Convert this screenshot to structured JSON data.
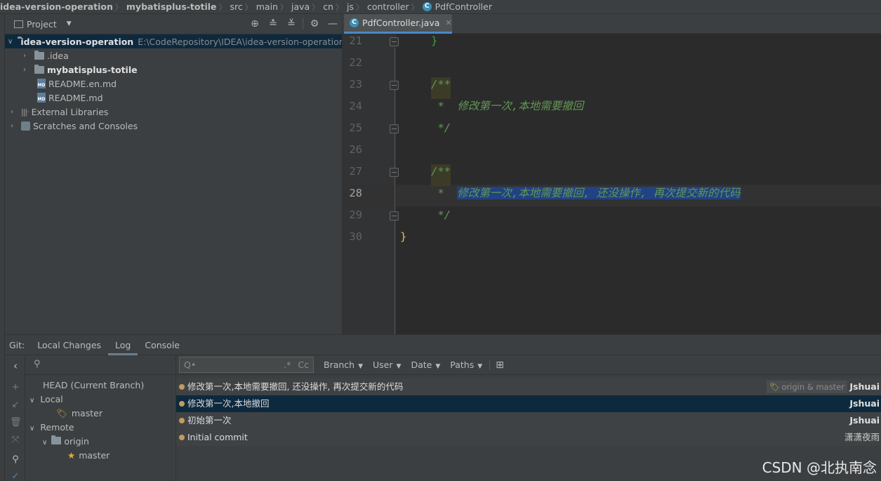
{
  "breadcrumb": [
    "idea-version-operation",
    "mybatisplus-totile",
    "src",
    "main",
    "java",
    "cn",
    "js",
    "controller",
    "PdfController"
  ],
  "project_panel": {
    "title": "Project",
    "root": {
      "name": "idea-version-operation",
      "path": "E:\\CodeRepository\\IDEA\\idea-version-operation"
    },
    "items": [
      ".idea",
      "mybatisplus-totile",
      "README.en.md",
      "README.md"
    ],
    "external_libraries": "External Libraries",
    "scratches": "Scratches and Consoles"
  },
  "editor": {
    "tab_label": "PdfController.java",
    "lines": [
      {
        "num": "21",
        "text": "}"
      },
      {
        "num": "22",
        "text": ""
      },
      {
        "num": "23",
        "text": "/**"
      },
      {
        "num": "24",
        "text": " *  修改第一次,本地需要撤回"
      },
      {
        "num": "25",
        "text": " */"
      },
      {
        "num": "26",
        "text": ""
      },
      {
        "num": "27",
        "text": "/**"
      },
      {
        "num": "28",
        "prefix": " *  ",
        "text": "修改第一次,本地需要撤回, 还没操作, 再次提交新的代码"
      },
      {
        "num": "29",
        "text": " */"
      },
      {
        "num": "30",
        "text": "}"
      }
    ]
  },
  "git": {
    "label": "Git:",
    "tabs": [
      "Local Changes",
      "Log",
      "Console"
    ],
    "branches": {
      "head": "HEAD (Current Branch)",
      "local": "Local",
      "local_master": "master",
      "remote": "Remote",
      "origin": "origin",
      "origin_master": "master"
    },
    "search_placeholder": "Q•",
    "regex_label": ".*",
    "case_label": "Cc",
    "filters": [
      "Branch",
      "User",
      "Date",
      "Paths"
    ],
    "commits": [
      {
        "message": "修改第一次,本地需要撤回, 还没操作, 再次提交新的代码",
        "refs": "origin & master",
        "author": "Jshuai"
      },
      {
        "message": "修改第一次,本地撤回",
        "author": "Jshuai"
      },
      {
        "message": "初始第一次",
        "author": "Jshuai"
      },
      {
        "message": "Initial commit",
        "author": "潇潇夜雨"
      }
    ]
  },
  "watermark": "CSDN @北执南念",
  "colors": {
    "accent": "#4a88c7",
    "selection": "#214283",
    "doc_comment": "#629755",
    "graph": "#c29c5c"
  }
}
